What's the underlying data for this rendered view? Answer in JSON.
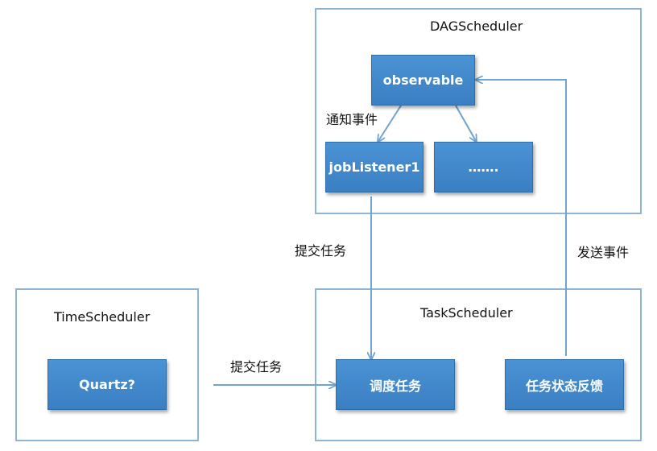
{
  "frames": {
    "dag": {
      "title": "DAGScheduler"
    },
    "task": {
      "title": "TaskScheduler"
    },
    "time": {
      "title": "TimeScheduler"
    }
  },
  "nodes": {
    "observable": "observable",
    "job_listener": "jobListener1",
    "ellipsis": "…….",
    "quartz": "Quartz?",
    "schedule_task": "调度任务",
    "task_status_feedback": "任务状态反馈"
  },
  "edge_labels": {
    "notify_event": "通知事件",
    "submit_task_upper": "提交任务",
    "send_event": "发送事件",
    "submit_task_lower": "提交任务"
  },
  "colors": {
    "node_fill": "#4a93d4",
    "frame_border": "#8fb4d6",
    "edge": "#6fa3d0"
  }
}
